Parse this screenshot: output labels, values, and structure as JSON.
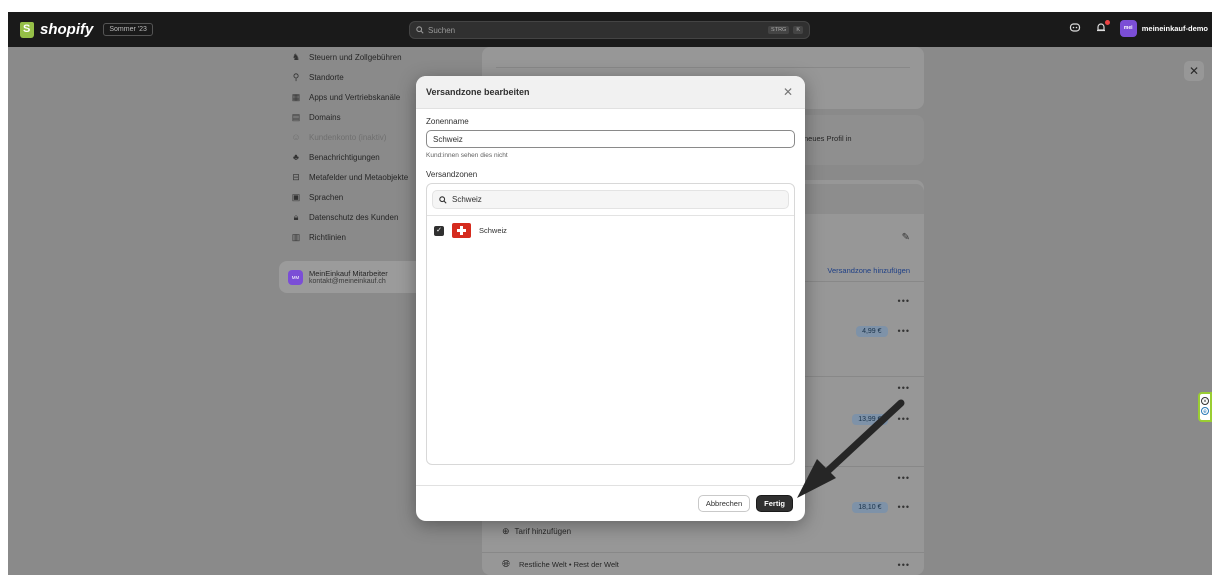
{
  "topbar": {
    "logo_text": "shopify",
    "edition_label": "Sommer '23",
    "search_placeholder": "Suchen",
    "shortcut_key1": "STRG",
    "shortcut_key2": "K",
    "store_initials": "mei",
    "store_name": "meineinkauf-demo",
    "colors": {
      "bar": "#1a1a1a",
      "logo_green": "#95bf47",
      "avatar": "#7b4ed6"
    }
  },
  "settings_nav": {
    "items": [
      {
        "label": "Steuern und Zollgebühren",
        "icon": "tax-icon",
        "disabled": false
      },
      {
        "label": "Standorte",
        "icon": "location-icon",
        "disabled": false
      },
      {
        "label": "Apps und Vertriebskanäle",
        "icon": "apps-icon",
        "disabled": false
      },
      {
        "label": "Domains",
        "icon": "domains-icon",
        "disabled": false
      },
      {
        "label": "Kundenkonto (inaktiv)",
        "icon": "customer-accounts-icon",
        "disabled": true
      },
      {
        "label": "Benachrichtigungen",
        "icon": "bell-icon",
        "disabled": false
      },
      {
        "label": "Metafelder und Metaobjekte",
        "icon": "metafields-icon",
        "disabled": false
      },
      {
        "label": "Sprachen",
        "icon": "languages-icon",
        "disabled": false
      },
      {
        "label": "Datenschutz des Kunden",
        "icon": "lock-icon",
        "disabled": false
      },
      {
        "label": "Richtlinien",
        "icon": "policies-icon",
        "disabled": false
      }
    ],
    "user": {
      "initials": "MM",
      "name": "MeinEinkauf Mitarbeiter",
      "email": "kontakt@meineinkauf.ch"
    }
  },
  "background": {
    "new_profile_text": "neues Profil in",
    "add_zone_link": "Versandzone hinzufügen",
    "prices": [
      "4,99 €",
      "13,99 €",
      "18,10 €"
    ],
    "add_rate_label": "Tarif hinzufügen",
    "rest_world_label": "Restliche Welt • Rest der Welt"
  },
  "modal": {
    "title": "Versandzone bearbeiten",
    "zone_name_label": "Zonenname",
    "zone_name_value": "Schweiz",
    "zone_name_help": "Kund:innen sehen dies nicht",
    "zones_label": "Versandzonen",
    "zone_search_value": "Schweiz",
    "zones": [
      {
        "name": "Schweiz",
        "checked": true,
        "flag_icon": "swiss-flag-icon"
      }
    ],
    "cancel_label": "Abbrechen",
    "done_label": "Fertig"
  }
}
